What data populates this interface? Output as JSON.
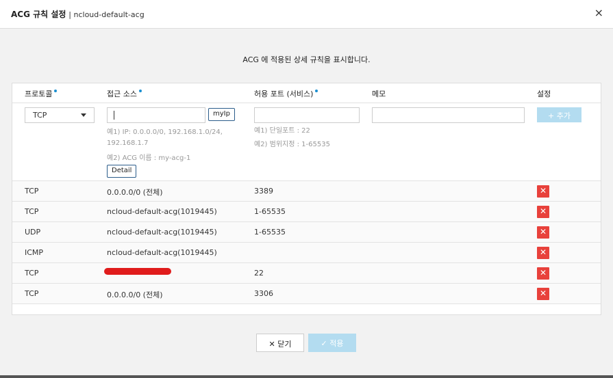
{
  "dialog": {
    "title_bold": "ACG 규칙 설정",
    "title_sub": "| ncloud-default-acg",
    "close_glyph": "×",
    "description": "ACG 에 적용된 상세 규칙을 표시합니다."
  },
  "columns": {
    "protocol": "프로토콜",
    "source": "접근 소스",
    "port": "허용 포트 (서비스)",
    "memo": "메모",
    "settings": "설정"
  },
  "form": {
    "protocol_value": "TCP",
    "source_value": "",
    "myip_label": "myIp",
    "source_hint1": "예1) IP: 0.0.0.0/0, 192.168.1.0/24,",
    "source_hint2": "192.168.1.7",
    "source_hint3": "예2) ACG 이름 : my-acg-1",
    "detail_label": "Detail",
    "port_value": "",
    "port_hint1": "예1) 단일포트 : 22",
    "port_hint2": "예2) 범위지정 : 1-65535",
    "memo_value": "",
    "add_label": "+ 추가"
  },
  "rules": [
    {
      "protocol": "TCP",
      "source": "0.0.0.0/0 (전체)",
      "port": "3389",
      "memo": ""
    },
    {
      "protocol": "TCP",
      "source": "ncloud-default-acg(1019445)",
      "port": "1-65535",
      "memo": ""
    },
    {
      "protocol": "UDP",
      "source": "ncloud-default-acg(1019445)",
      "port": "1-65535",
      "memo": ""
    },
    {
      "protocol": "ICMP",
      "source": "ncloud-default-acg(1019445)",
      "port": "",
      "memo": ""
    },
    {
      "protocol": "TCP",
      "source": "",
      "port": "22",
      "memo": ""
    },
    {
      "protocol": "TCP",
      "source": "0.0.0.0/0 (전체)",
      "port": "3306",
      "memo": ""
    }
  ],
  "delete_glyph": "✕",
  "footer": {
    "close_label": "✕ 닫기",
    "apply_label": "✓ 적용"
  },
  "colors": {
    "delete": "#e8413b",
    "primary_disabled": "#b3dcf0",
    "required_dot": "#1a8fd0"
  }
}
